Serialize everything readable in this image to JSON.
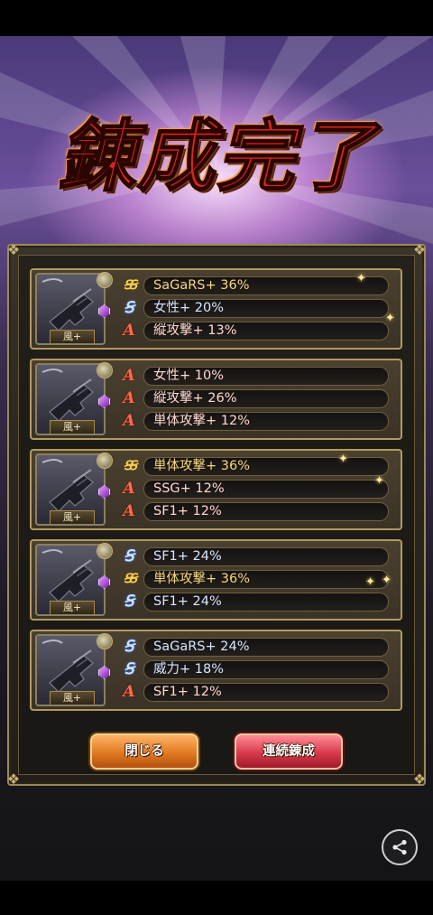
{
  "title": "錬成完了",
  "cards": [
    {
      "weapon_tag": "風+",
      "lines": [
        {
          "rank": "SS",
          "text": "SaGaRS+ 36%"
        },
        {
          "rank": "S",
          "text": "女性+ 20%"
        },
        {
          "rank": "A",
          "text": "縦攻撃+ 13%"
        }
      ]
    },
    {
      "weapon_tag": "風+",
      "lines": [
        {
          "rank": "A",
          "text": "女性+ 10%"
        },
        {
          "rank": "A",
          "text": "縦攻撃+ 26%"
        },
        {
          "rank": "A",
          "text": "単体攻撃+ 12%"
        }
      ]
    },
    {
      "weapon_tag": "風+",
      "lines": [
        {
          "rank": "SS",
          "text": "単体攻撃+ 36%"
        },
        {
          "rank": "A",
          "text": "SSG+ 12%"
        },
        {
          "rank": "A",
          "text": "SF1+ 12%"
        }
      ]
    },
    {
      "weapon_tag": "風+",
      "lines": [
        {
          "rank": "S",
          "text": "SF1+ 24%"
        },
        {
          "rank": "SS",
          "text": "単体攻撃+ 36%"
        },
        {
          "rank": "S",
          "text": "SF1+ 24%"
        }
      ]
    },
    {
      "weapon_tag": "風+",
      "lines": [
        {
          "rank": "S",
          "text": "SaGaRS+ 24%"
        },
        {
          "rank": "S",
          "text": "威力+ 18%"
        },
        {
          "rank": "A",
          "text": "SF1+ 12%"
        }
      ]
    }
  ],
  "buttons": {
    "close_label": "閉じる",
    "continue_label": "連続錬成"
  },
  "icons": {
    "share": "share-icon",
    "weapon": "pistol-icon",
    "rank_ss": "rank-ss-icon",
    "rank_s": "rank-s-icon",
    "rank_a": "rank-a-icon"
  },
  "colors": {
    "rank_ss": "#f6cf5a",
    "rank_s": "#cfe3ff",
    "rank_a": "#ff6a4a",
    "title": "#d8251a",
    "close_button": "#e07a20",
    "continue_button": "#d83a4a"
  }
}
